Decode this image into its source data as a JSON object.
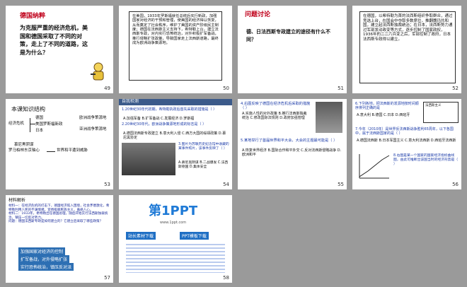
{
  "slides": [
    {
      "num": "49",
      "title": "德国纳粹",
      "body": "为克服严重的经济危机，美国和德国采取了不同的对策，走上了不同的道路，这是为什么？"
    },
    {
      "num": "50",
      "body": "在美国，1933年罗斯福就任总统后实行新政，加强国家对经济的干预和管理，使美国的经济得以恢复，从而奠定了社会秩序，维护了美国的资产阶级民主制度；德国在法西斯主义支持下，希特勒上台，建立法西斯专政，对内实行恐怖统治，对外积极扩军备战，推行侵略扩张政策，导致国家走上法西斯道路，最终成为欧洲战争策源地。"
    },
    {
      "num": "51",
      "title": "问题讨论",
      "body": "德、日法西斯专政建立的途径有什么不同？"
    },
    {
      "num": "52",
      "body": "在德国，以希特勒为首的法西斯组织争取群众，通过竞选上台，在国会中夺取多数席位，推翻魏玛共和国，建立起法西斯独裁统治；在日本，法西斯势力通过军部发动政变等方式，逐步控制了国家政权，1936年的二二六兵变之后，军部控制了政府，日本法西斯专政得以建立。"
    },
    {
      "num": "53",
      "title": "本课知识结构",
      "nodes": [
        "经济危机",
        "德国",
        "美国罗斯福新政",
        "日本",
        "欧洲战争策源地",
        "亚洲战争策源地",
        "慕尼黑阴谋",
        "罗马柏林东京轴心",
        "世界和平遭到威胁"
      ]
    },
    {
      "num": "54",
      "title": "自我检测",
      "q1": "1.20世纪30年代初期，希特勒执政后首先采取的措施是（ ）",
      "q1opts": "A.加强军备  B.扩军备战  C.发展经济  D.罗斯福",
      "q2": "2.20世纪30年代，欧洲战争策源地形成的标志是（ ）",
      "q2opts": "A.德国法西斯专政建立  B.意大利入侵  C.西方大国的绥靖政策  D.慕尼黑协定",
      "q3": "3.图片为苏联历史纪念馆中收藏的某事件照片，该事件反映了（ ）",
      "q3opts": "A.慕尼黑阴谋  B.二战爆发  C.法西斯德国  D.集体安全"
    },
    {
      "num": "55",
      "q1": "4.右图反映了德国在经济危机后采取的措施（ ）",
      "q1opts": "A.实施人性的对外政策  B.推行法西斯独裁统治  C.修改国际法规则  D.政府加强管理",
      "q2": "5.某地举行了首届世界和平大会，大会的主题最可能是（ ）",
      "q2opts": "A.恢复世界经济  B.国际合作和平外交  C.反对法西斯侵略战争  D.欧洲和平"
    },
    {
      "num": "56",
      "q1": "6.下列各地，把法西斯的发源地按时间顺序排列正确的是",
      "q1opts": "A.意大利  B.德国  C.日本  D.西班牙",
      "legend": "法西斯主义",
      "q2": "7.今年（2010年）是世界反法西斯战争胜利65周年，以下各国中，属于法西斯国家的是（ ）",
      "q2opts": "A.德国法西斯  B.日本军国主义  C.意大利法西斯  D.西班牙法西斯",
      "q3": "8.右图是某一个国家的国家经济指标曲线图，由此可推断出该国当时的经济形势是（ ）"
    },
    {
      "num": "57",
      "title": "材料解析",
      "body": "材料一：在经济危机的打击下，德国经济陷入困境，社会矛盾激化，希特勒利用人民的不满情绪，宣扬极端民族主义，蛊惑人心。\n材料二：1933年，希特勒出任德国总理，随后开始实行法西斯独裁统治，镇压一切反对势力。\n问题：德国法西斯专政是如何建立的？它建立后采取了哪些政策？",
      "answers": [
        "加强国家对经济的控制",
        "扩军备战，对外侵略扩张",
        "实行恐怖统治，镇压反对派"
      ]
    },
    {
      "num": "58",
      "logo": "第1PPT",
      "sub": "www.1ppt.com",
      "btn1": "站长素材下载",
      "btn2": "PPT模板下载"
    }
  ]
}
